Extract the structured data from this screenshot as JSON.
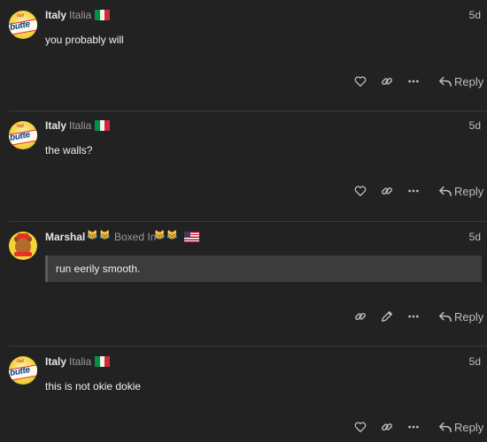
{
  "posts": [
    {
      "username": "Italy",
      "user_title": "Italia",
      "flag": "italy-flag",
      "date": "5d",
      "body": "you probably will",
      "actions": [
        "heart-icon",
        "link-icon",
        "more-icon"
      ],
      "reply_label": "Reply"
    },
    {
      "username": "Italy",
      "user_title": "Italia",
      "flag": "italy-flag",
      "date": "5d",
      "body": "the walls?",
      "actions": [
        "heart-icon",
        "link-icon",
        "more-icon"
      ],
      "reply_label": "Reply"
    },
    {
      "username": "Marshal",
      "user_title": "Boxed In",
      "flag": "usa-flag",
      "badges_before_title": [
        "cat-emoji",
        "cat-emoji"
      ],
      "badges_after_title": [
        "cat-emoji",
        "cat-emoji"
      ],
      "date": "5d",
      "quote": "run eerily smooth.",
      "actions": [
        "link-icon",
        "edit-icon",
        "more-icon"
      ],
      "reply_label": "Reply"
    },
    {
      "username": "Italy",
      "user_title": "Italia",
      "flag": "italy-flag",
      "date": "5d",
      "body": "this is not okie dokie",
      "actions": [
        "heart-icon",
        "link-icon",
        "more-icon"
      ],
      "reply_label": "Reply"
    }
  ],
  "colors": {
    "background": "#222222",
    "divider": "#3a3a3a",
    "quote_bg": "#3c3c3c",
    "italy_green": "#009246",
    "italy_red": "#ce2b37"
  }
}
